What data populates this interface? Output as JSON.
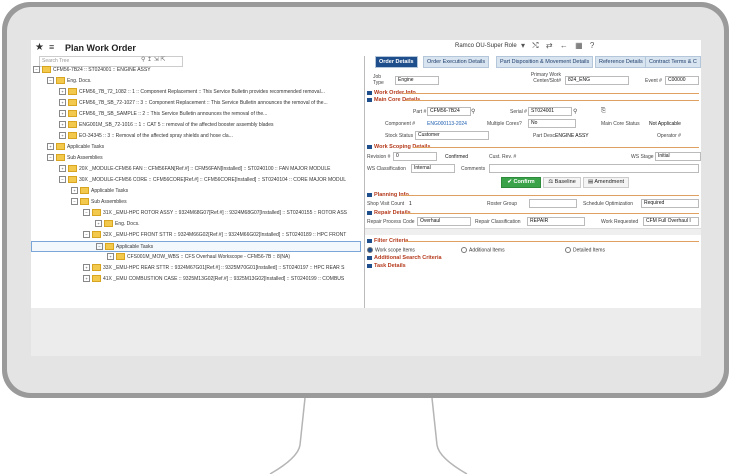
{
  "app": {
    "title": "Plan Work Order",
    "right_label": "Ramco OU-Super Role"
  },
  "tree": {
    "search_placeholder": "Search Tree",
    "items": [
      "CFM56-7B24 :: ST024001 :: ENGINE ASSY",
      "Eng. Docs.",
      "CFM56_7B_72_1082 :: 1 :: Component Replacement :: This Service Bulletin provides recommended removal...",
      "CFM56_7B_SB_72-1027 :: 3 :: Component Replacement :: This Service Bulletin announces the removal of the...",
      "CFM56_7B_SB_SAMPLE :: 2 :: This Service Bulletin announces the removal of the...",
      "ENG001M_SB_72-1016 :: 1 :: CAT 5 :: removal of the affected booster assembly blades",
      "EO-34345 :: 3 :: Removal of the affected spray shields and hose cla...",
      "Applicable Tasks",
      "Sub Assemblies",
      "20X _MODULE-CFM56 FAN :: CFM56FAN[Ref.#] :: CFM56FAN[Installed] :: ST0240100 :: FAN MAJOR MODULE",
      "30X _MODULE-CFM56 CORE :: CFM56CORE[Ref.#] :: CFM56CORE[Installed] :: ST0240104 :: CORE MAJOR MODUL",
      "Applicable Tasks",
      "Sub Assemblies",
      "31X _EMU-HPC ROTOR ASSY :: 9324M68G07[Ref.#] :: 9324M68G07[Installed] :: ST0240155 :: ROTOR ASS",
      "Eng. Docs.",
      "32X _EMU-HPC FRONT STTR :: 9324M66G02[Ref.#] :: 9324M66G02[Installed] :: ST0240189 :: HPC FRONT",
      "Applicable Tasks",
      "CFS001M_MOW_WBS :: CFS Overhaul Workscope - CFM56-7B :: 8(NA)",
      "33X _EMU-HPC REAR STTR :: 9324M67G01[Ref.#] :: 9325M70G01[Installed] :: ST0240197 :: HPC REAR S",
      "41X _EMU COMBUSTION CASE :: 9325M13G02[Ref.#] :: 9325M13G02[Installed] :: ST0240199 :: COMBUS"
    ]
  },
  "tabs": [
    "Order Details",
    "Order Execution Details",
    "Part Disposition & Movement Details",
    "Reference Details",
    "Contract Terms & C"
  ],
  "header_fields": {
    "job_type_label": "Job Type",
    "job_type_value": "Engine",
    "primary_work_center_label": "Primary Work Center/Slot#",
    "primary_work_center_value": "824_ENG",
    "event_label": "Event #",
    "event_value": "C00000"
  },
  "work_order_info": {
    "section": "Work Order Info",
    "main_core": "Main Core Details",
    "part_label": "Part #",
    "part_value": "CFM56-7B24",
    "serial_label": "Serial #",
    "serial_value": "ST024001",
    "component_label": "Component #",
    "component_value": "ENG000113-2024",
    "multiple_cores_label": "Multiple Cores?",
    "multiple_cores_value": "No",
    "main_core_status_label": "Main Core Status",
    "main_core_status_value": "Not Applicable",
    "stock_status_label": "Stock Status",
    "stock_status_value": "Customer",
    "part_desc_label": "Part Desc.",
    "part_desc_value": "ENGINE ASSY",
    "operator_label": "Operator #"
  },
  "work_scoping": {
    "section": "Work Scoping Details",
    "revision_label": "Revision #",
    "revision_value": "0",
    "confirmed": "Confirmed",
    "cust_rev_label": "Cust. Rev. #",
    "ws_stage_label": "WS Stage",
    "ws_stage_value": "Initial",
    "ws_class_label": "WS Classification",
    "ws_class_value": "Internal",
    "comments_label": "Comments",
    "confirm_btn": "Confirm",
    "baseline_btn": "Baseline",
    "amendment_btn": "Amendment"
  },
  "planning": {
    "section": "Planning Info",
    "shop_visit_label": "Shop Visit Count",
    "shop_visit_value": "1",
    "roster_label": "Roster Group",
    "schedule_label": "Schedule Optimization",
    "schedule_value": "Required"
  },
  "repair": {
    "section": "Repair Details",
    "process_label": "Repair Process Code",
    "process_value": "Overhaul",
    "class_label": "Repair Classification",
    "class_value": "REPAIR",
    "requested_label": "Work Requested",
    "requested_value": "CFM Full Overhaul I"
  },
  "filter": {
    "section": "Filter Criteria",
    "opt1": "Work scope Items",
    "opt2": "Additional Items",
    "opt3": "Detailed Items",
    "additional": "Additional Search Criteria",
    "task": "Task Details"
  }
}
